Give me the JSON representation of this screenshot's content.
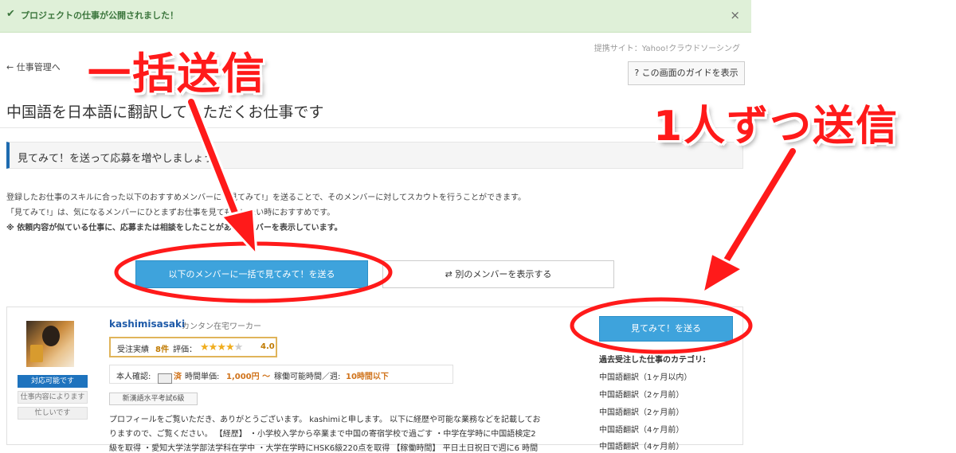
{
  "notice": {
    "message": "プロジェクトの仕事が公開されました！",
    "close_icon": "×"
  },
  "provider": "提携サイト：Yahoo!クラウドソーシング",
  "back_link": "← 仕事管理へ",
  "guide_button": "? この画面のガイドを表示",
  "page_title": "中国語を日本語に翻訳していただくお仕事です",
  "section_title": "見てみて！を送って応募を増やしましょう",
  "description": {
    "line1": "登録したお仕事のスキルに合った以下のおすすめメンバーに「見てみて!」を送ることで、そのメンバーに対してスカウトを行うことができます。",
    "line2": "「見てみて!」は、気になるメンバーにひとまずお仕事を見てもらいたい時におすすめです。",
    "line3": "※ 依頼内容が似ている仕事に、応募または相談をしたことがあるメンバーを表示しています。"
  },
  "buttons": {
    "bulk_send": "以下のメンバーに一括で見てみて！を送る",
    "other_members": "⇄ 別のメンバーを表示する",
    "send_one": "見てみて！を送る"
  },
  "member": {
    "username": "kashimisasaki",
    "type": "カンタン在宅ワーカー",
    "rating_label": "受注実績",
    "order_count": "8件",
    "eval_label": "評価：",
    "stars": 4,
    "score": "4.0",
    "id_label": "本人確認:",
    "id_status": "済",
    "rate_label": "時間単価:",
    "rate_value": "1,000円 〜",
    "hours_label": "稼働可能時間／週:",
    "hours_value": "10時間以下",
    "status_available": "対応可能です",
    "status_depends": "仕事内容によります",
    "status_busy": "忙しいです",
    "skill_tag": "新漢語水平考試6級",
    "profile_line1": "プロフィールをご覧いただき、ありがとうございます。 kashimiと申します。 以下に経歴や可能な業務などを記載してお",
    "profile_line2": "りますので、ご覧ください。 【経歴】 ・小学校入学から卒業まで中国の寄宿学校で過ごす ・中学在学時に中国語検定2",
    "profile_line3": "級を取得 ・愛知大学法学部法学科在学中 ・大学在学時にHSK6級220点を取得 【稼働時間】 平日土日祝日で週に6 時間"
  },
  "categories": {
    "heading": "過去受注した仕事のカテゴリ:",
    "items": [
      "中国語翻訳（1ヶ月以内）",
      "中国語翻訳（2ヶ月前）",
      "中国語翻訳（2ヶ月前）",
      "中国語翻訳（4ヶ月前）",
      "中国語翻訳（4ヶ月前）"
    ]
  },
  "annotations": {
    "bulk": "一括送信",
    "single": "1人ずつ送信"
  },
  "colors": {
    "accent": "#3ea3dc",
    "annotation": "#ff1a1a",
    "notice_bg": "#dff0d8"
  }
}
